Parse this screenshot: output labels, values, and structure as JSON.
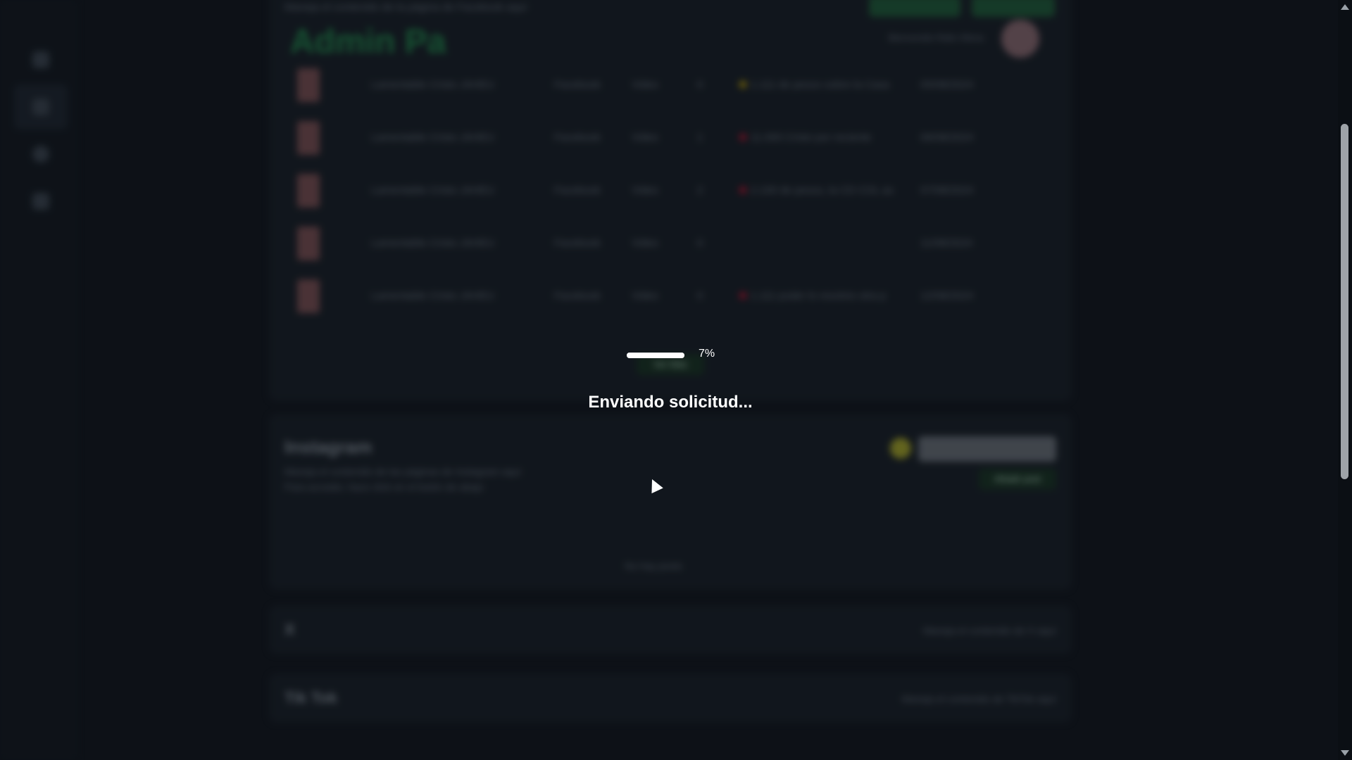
{
  "bg": {
    "admin_title": "Admin Pa",
    "top_subtitle": "Maneja el contenido de la página de Facebook aquí",
    "user_line": "Bienvenido Rafa Vilena",
    "fb": {
      "rows": [
        {
          "title": "Lamentable Cristo JAHEU",
          "source": "Facebook",
          "type": "Video",
          "num": "0",
          "summary": "1.111 de pesos sobre la Casa",
          "date": "05/08/2024",
          "dot": "#d4b000"
        },
        {
          "title": "Lamentable Cristo JAHEU",
          "source": "Facebook",
          "type": "Video",
          "num": "1",
          "summary": "11.000 Cristo por reciente",
          "date": "06/08/2024",
          "dot": "#c8102e"
        },
        {
          "title": "Lamentable Cristo JAHEU",
          "source": "Facebook",
          "type": "Video",
          "num": "2",
          "summary": "2.100 de pesos, la CD COL as",
          "date": "07/08/2024",
          "dot": "#c8102e"
        },
        {
          "title": "Lamentable Cristo JAHEU",
          "source": "Facebook",
          "type": "Video",
          "num": "0",
          "summary": "",
          "date": "11/08/2024",
          "dot": ""
        },
        {
          "title": "Lamentable Cristo JAHEU",
          "source": "Facebook",
          "type": "Video",
          "num": "0",
          "summary": "1.111 poder lo resolvio otra p",
          "date": "12/08/2024",
          "dot": "#c8102e"
        }
      ],
      "see_more": "Ver Más"
    },
    "ig": {
      "title": "Instagram",
      "desc1": "Maneja el contenido de las páginas de Instagram aquí",
      "desc2": "Para acceder, hace click en el botón de abajo",
      "add_button": "Añadir post",
      "empty": "No hay posts"
    },
    "x": {
      "title": "X",
      "note": "Maneja el contenido de X aquí"
    },
    "tiktok": {
      "title": "Tik Tok",
      "note": "Maneja el contenido de TikTok aquí"
    }
  },
  "overlay": {
    "progress_percent": 7,
    "progress_label": "7%",
    "status": "Enviando solicitud..."
  },
  "colors": {
    "accent_green": "#1f8a4a",
    "overlay_text": "#ffffff"
  }
}
